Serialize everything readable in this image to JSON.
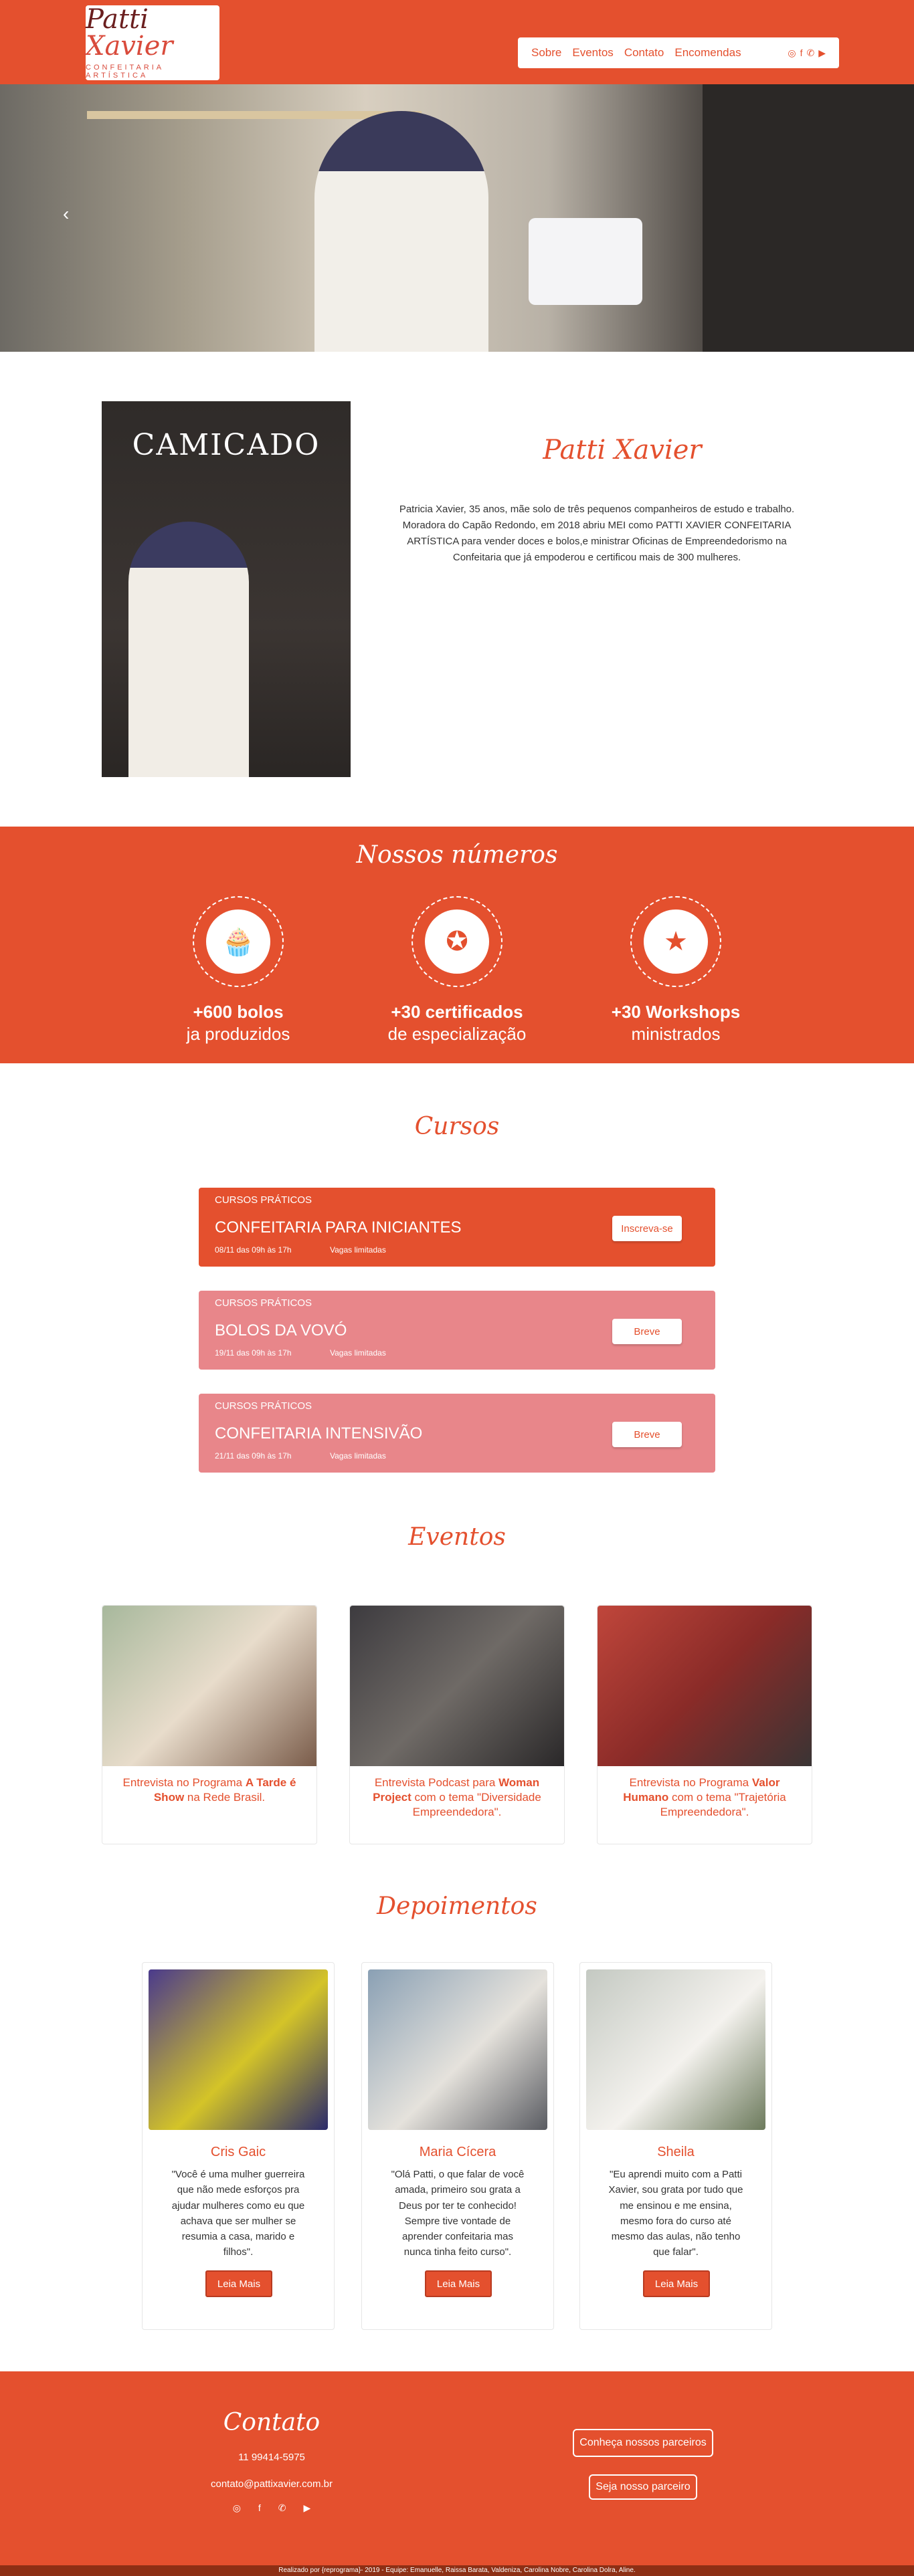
{
  "header": {
    "logo_text_a": "Patti",
    "logo_text_b": "Xavier",
    "logo_subtitle": "CONFEITARIA ARTÍSTICA",
    "nav": [
      "Sobre",
      "Eventos",
      "Contato",
      "Encomendas"
    ]
  },
  "about": {
    "photo_brand": "CAMICADO",
    "title": "Patti Xavier",
    "text": "Patricia Xavier, 35 anos, mãe solo de três pequenos companheiros de estudo e trabalho. Moradora do Capão Redondo, em 2018 abriu MEI como PATTI XAVIER CONFEITARIA ARTÍSTICA para vender doces e bolos,e ministrar Oficinas de Empreendedorismo na Confeitaria que já empoderou e certificou mais de 300 mulheres."
  },
  "numbers": {
    "title": "Nossos números",
    "stats": [
      {
        "big": "+600 bolos",
        "small": "ja produzidos",
        "icon": "cupcake-icon"
      },
      {
        "big": "+30 certificados",
        "small": "de especialização",
        "icon": "award-icon"
      },
      {
        "big": "+30 Workshops",
        "small": "ministrados",
        "icon": "workshop-icon"
      }
    ]
  },
  "courses": {
    "title": "Cursos",
    "items": [
      {
        "cat": "CURSOS PRÁTICOS",
        "name": "CONFEITARIA PARA INICIANTES",
        "date": "08/11 das 09h às 17h",
        "vagas": "Vagas limitadas",
        "btn": "Inscreva-se"
      },
      {
        "cat": "CURSOS PRÁTICOS",
        "name": "BOLOS DA VOVÓ",
        "date": "19/11 das 09h às 17h",
        "vagas": "Vagas limitadas",
        "btn": "Breve"
      },
      {
        "cat": "CURSOS PRÁTICOS",
        "name": "CONFEITARIA INTENSIVÃO",
        "date": "21/11 das 09h às 17h",
        "vagas": "Vagas limitadas",
        "btn": "Breve"
      }
    ]
  },
  "events": {
    "title": "Eventos",
    "items": [
      {
        "pre": "Entrevista no Programa ",
        "bold": "A Tarde é Show",
        "post": " na Rede Brasil."
      },
      {
        "pre": "Entrevista Podcast para ",
        "bold": "Woman Project",
        "post": " com o tema \"Diversidade Empreendedora\"."
      },
      {
        "pre": "Entrevista no Programa ",
        "bold": "Valor Humano",
        "post": " com o tema \"Trajetória Empreendedora\"."
      }
    ]
  },
  "testimonials": {
    "title": "Depoimentos",
    "items": [
      {
        "name": "Cris Gaic",
        "quote": "\"Você é uma mulher guerreira que não mede esforços pra ajudar mulheres como eu que achava que ser mulher se resumia a casa, marido e filhos\".",
        "btn": "Leia Mais"
      },
      {
        "name": "Maria Cícera",
        "quote": "\"Olá Patti, o que falar de você amada, primeiro sou grata a Deus por ter te conhecido! Sempre tive vontade de aprender confeitaria mas nunca tinha feito curso\".",
        "btn": "Leia Mais"
      },
      {
        "name": "Sheila",
        "quote": "\"Eu aprendi muito com a Patti Xavier, sou grata por tudo que me ensinou e me ensina, mesmo fora do curso até mesmo das aulas, não tenho que falar\".",
        "btn": "Leia Mais"
      }
    ]
  },
  "contact": {
    "title": "Contato",
    "phone": "11 99414-5975",
    "email": "contato@pattixavier.com.br",
    "btn_partners": "Conheça nossos parceiros",
    "btn_partner": "Seja nosso parceiro"
  },
  "footer": {
    "text": "Realizado por {reprograma}- 2019 - Equipe: Emanuelle, Raissa Barata, Valdeniza, Carolina Nobre, Carolina Dolra, Aline."
  },
  "colors": {
    "brand": "#e4502e",
    "soon": "#e8868a"
  }
}
